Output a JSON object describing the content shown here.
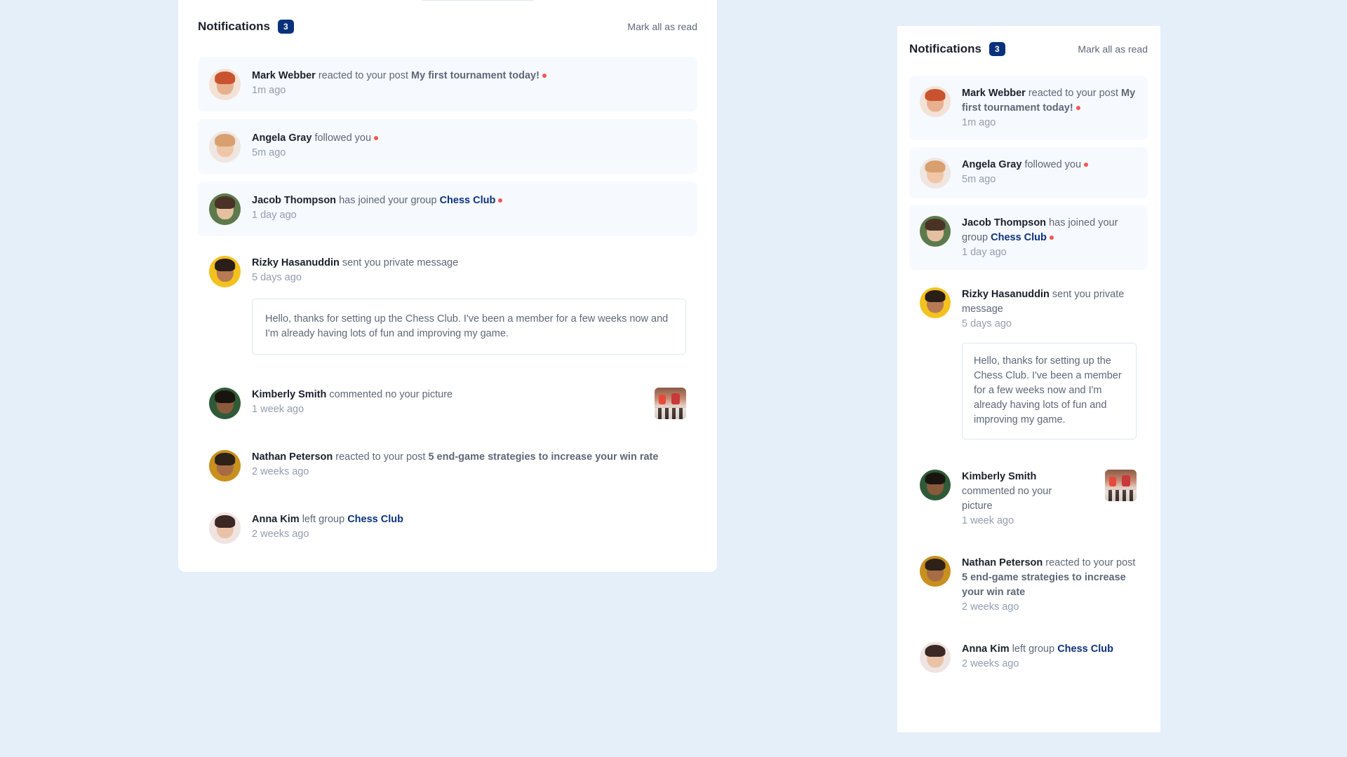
{
  "notifications": {
    "title": "Notifications",
    "count": "3",
    "mark_all_label": "Mark all as read",
    "items": [
      {
        "name": "Mark Webber",
        "action": "reacted to your post",
        "post": "My first tournament today!",
        "time": "1m ago",
        "unread": true
      },
      {
        "name": "Angela Gray",
        "action": "followed you",
        "time": "5m ago",
        "unread": true
      },
      {
        "name": "Jacob Thompson",
        "action": "has joined your group",
        "group": "Chess Club",
        "time": "1 day ago",
        "unread": true
      },
      {
        "name": "Rizky Hasanuddin",
        "action": "sent you private message",
        "time": "5 days ago",
        "unread": false,
        "message": "Hello, thanks for setting up the Chess Club. I've been a member for a few weeks now and I'm already having lots of fun and improving my game."
      },
      {
        "name": "Kimberly Smith",
        "action": "commented no your picture",
        "time": "1 week ago",
        "unread": false
      },
      {
        "name": "Nathan Peterson",
        "action": "reacted to your post",
        "post": "5 end-game strategies to increase your win rate",
        "time": "2 weeks ago",
        "unread": false
      },
      {
        "name": "Anna Kim",
        "action": "left group",
        "group": "Chess Club",
        "time": "2 weeks ago",
        "unread": false
      }
    ]
  },
  "colors": {
    "background": "#e5eff9",
    "panel": "#ffffff",
    "unread_bg": "#f6f9fd",
    "badge": "#0a327b",
    "dot": "#f65552",
    "heading": "#1c202b",
    "text": "#5e6778",
    "muted": "#939cad"
  },
  "icons": {
    "unread_dot": "red-dot",
    "avatars": [
      "avatar-mark-webber",
      "avatar-angela-gray",
      "avatar-jacob-thompson",
      "avatar-rizky-hasanuddin",
      "avatar-kimberly-smith",
      "avatar-nathan-peterson",
      "avatar-anna-kim"
    ],
    "picture_thumb": "chess-picture-thumbnail"
  }
}
